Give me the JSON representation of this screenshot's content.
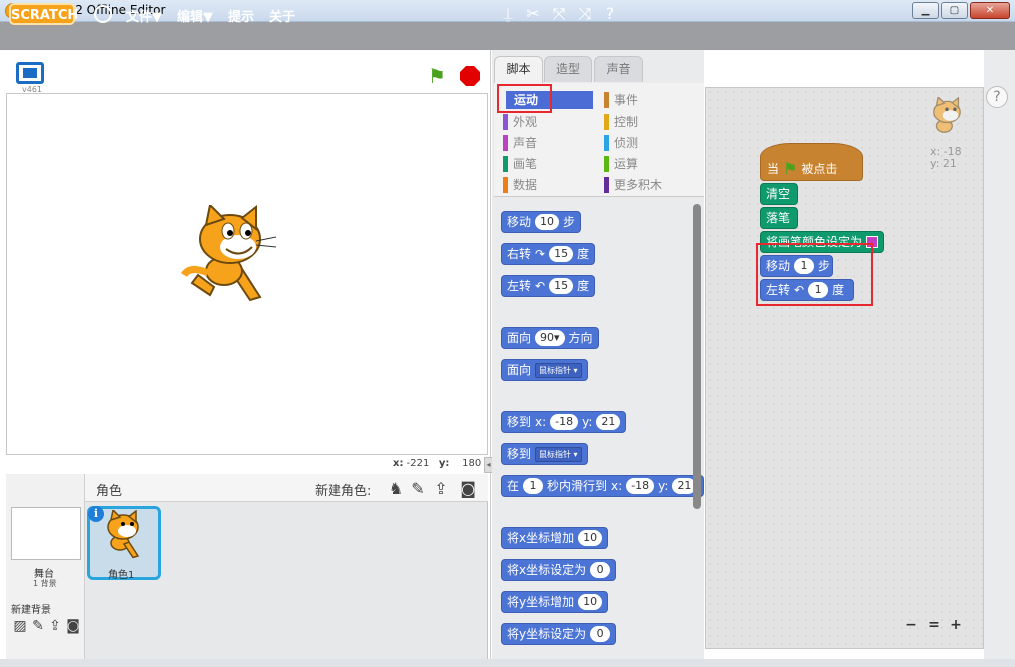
{
  "window": {
    "title": "Scratch 2 Offline Editor",
    "min_label": "▁",
    "max_label": "▢",
    "close_label": "✕"
  },
  "menubar": {
    "logo": "SCRATCH",
    "file": "文件▼",
    "edit": "编辑▼",
    "tips": "提示",
    "about": "关于"
  },
  "toolbar": {
    "duplicate": "⍊",
    "cut": "✂",
    "grow": "⤧",
    "shrink": "⤨",
    "help": "?"
  },
  "stage": {
    "version": "v461",
    "green_flag": "⚑",
    "mouse_x_label": "x:",
    "mouse_x": "-221",
    "mouse_y_label": "y:",
    "mouse_y": "180"
  },
  "sprites_pane": {
    "title": "角色",
    "new_sprite": "新建角色:",
    "new_sprite_icons": [
      "library-icon",
      "paint-icon",
      "upload-icon",
      "camera-icon"
    ],
    "stage_name": "舞台",
    "backdrop_count": "1 背景",
    "new_backdrop": "新建背景",
    "sprite_name": "角色1",
    "info": "i"
  },
  "tabs": {
    "scripts": "脚本",
    "costumes": "造型",
    "sounds": "声音"
  },
  "categories": {
    "motion": "运动",
    "looks": "外观",
    "sound": "声音",
    "pen": "画笔",
    "data": "数据",
    "events": "事件",
    "control": "控制",
    "sensing": "侦测",
    "operators": "运算",
    "more": "更多积木"
  },
  "palette": {
    "move": {
      "label": "移动",
      "value": "10",
      "suffix": "步"
    },
    "turn_right": {
      "label": "右转",
      "icon": "↷",
      "value": "15",
      "suffix": "度"
    },
    "turn_left": {
      "label": "左转",
      "icon": "↶",
      "value": "15",
      "suffix": "度"
    },
    "point_dir": {
      "label": "面向",
      "value": "90▾",
      "suffix": "方向"
    },
    "point_towards": {
      "label": "面向",
      "value": "鼠标指针 ▾"
    },
    "goto_xy": {
      "label": "移到",
      "x_label": "x:",
      "x": "-18",
      "y_label": "y:",
      "y": "21"
    },
    "goto": {
      "label": "移到",
      "value": "鼠标指针 ▾"
    },
    "glide": {
      "label": "在",
      "secs": "1",
      "mid": "秒内滑行到",
      "x_label": "x:",
      "x": "-18",
      "y_label": "y:",
      "y": "21"
    },
    "change_x": {
      "label": "将x坐标增加",
      "value": "10"
    },
    "set_x": {
      "label": "将x坐标设定为",
      "value": "0"
    },
    "change_y": {
      "label": "将y坐标增加",
      "value": "10"
    },
    "set_y": {
      "label": "将y坐标设定为",
      "value": "0"
    }
  },
  "script": {
    "hat_prefix": "当",
    "hat_suffix": "被点击",
    "clear": "清空",
    "pen_down": "落笔",
    "set_pen_color": "将画笔颜色设定为",
    "move_label": "移动",
    "move_value": "1",
    "move_suffix": "步",
    "turn_label": "左转",
    "turn_value": "1",
    "turn_suffix": "度"
  },
  "sprite_info": {
    "x": "x: -18",
    "y": "y: 21"
  },
  "zoom": {
    "out": "−",
    "reset": "=",
    "in": "+"
  },
  "colors": {
    "motion": "#4c74d4",
    "pen": "#0e9a6c",
    "events": "#c88330",
    "highlight": "#e8282f"
  }
}
